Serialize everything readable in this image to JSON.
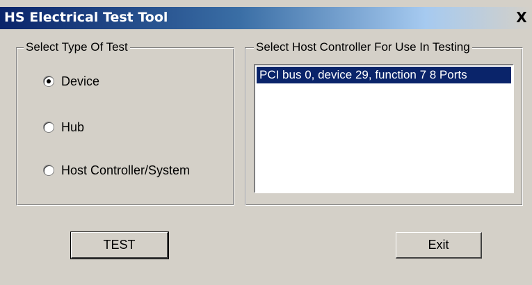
{
  "window": {
    "title": "HS Electrical Test Tool",
    "close_label": "X"
  },
  "test_type": {
    "legend": "Select Type Of Test",
    "options": [
      {
        "label": "Device",
        "selected": true
      },
      {
        "label": "Hub",
        "selected": false
      },
      {
        "label": "Host Controller/System",
        "selected": false
      }
    ]
  },
  "host_controller": {
    "legend": "Select Host Controller For Use In Testing",
    "items": [
      {
        "label": "PCI bus 0, device 29, function 7  8 Ports",
        "selected": true
      }
    ]
  },
  "buttons": {
    "test_label": "TEST",
    "exit_label": "Exit"
  },
  "colors": {
    "title_start": "#0a246a",
    "selection": "#0a246a",
    "face": "#d4d0c8"
  }
}
